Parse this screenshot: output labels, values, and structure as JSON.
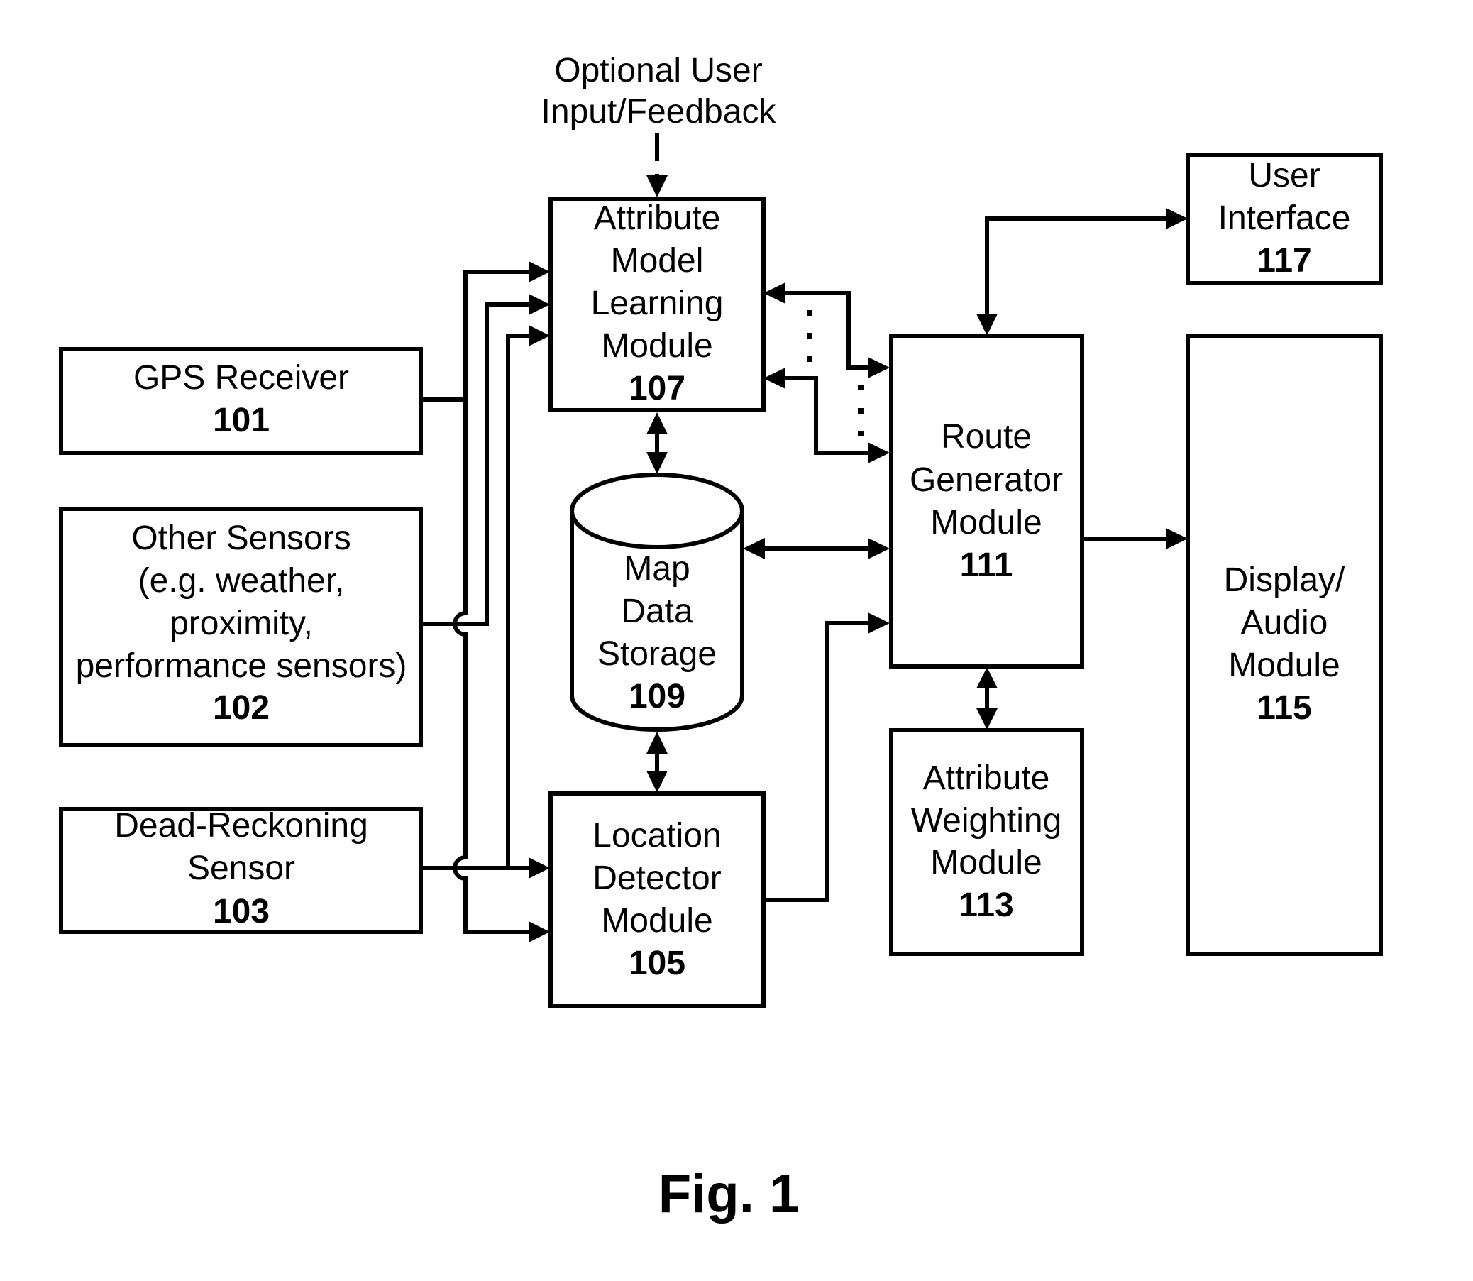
{
  "figure": {
    "caption": "Fig. 1",
    "external_input": {
      "lines": [
        "Optional User",
        "Input/Feedback"
      ]
    },
    "blocks": {
      "gps": {
        "lines": [
          "GPS Receiver"
        ],
        "ref": "101"
      },
      "other_sensors": {
        "lines": [
          "Other Sensors",
          "(e.g. weather,",
          "proximity,",
          "performance sensors)"
        ],
        "ref": "102"
      },
      "dead_reckoning": {
        "lines": [
          "Dead-Reckoning",
          "Sensor"
        ],
        "ref": "103"
      },
      "location_detector": {
        "lines": [
          "Location",
          "Detector",
          "Module"
        ],
        "ref": "105"
      },
      "attribute_model_learning": {
        "lines": [
          "Attribute",
          "Model",
          "Learning",
          "Module"
        ],
        "ref": "107"
      },
      "map_data_storage": {
        "lines": [
          "Map",
          "Data",
          "Storage"
        ],
        "ref": "109"
      },
      "route_generator": {
        "lines": [
          "Route",
          "Generator",
          "Module"
        ],
        "ref": "111"
      },
      "attribute_weighting": {
        "lines": [
          "Attribute",
          "Weighting",
          "Module"
        ],
        "ref": "113"
      },
      "display_audio": {
        "lines": [
          "Display/",
          "Audio",
          "Module"
        ],
        "ref": "115"
      },
      "user_interface": {
        "lines": [
          "User",
          "Interface"
        ],
        "ref": "117"
      }
    },
    "connections": [
      {
        "from": "Optional User Input/Feedback",
        "to": "107",
        "style": "dashed",
        "direction": "one-way"
      },
      {
        "from": "101",
        "to": "107",
        "direction": "one-way"
      },
      {
        "from": "101",
        "to": "105",
        "direction": "one-way"
      },
      {
        "from": "102",
        "to": "107",
        "direction": "one-way"
      },
      {
        "from": "103",
        "to": "107",
        "direction": "one-way"
      },
      {
        "from": "103",
        "to": "105",
        "direction": "one-way"
      },
      {
        "from": "107",
        "to": "109",
        "direction": "two-way"
      },
      {
        "from": "109",
        "to": "105",
        "direction": "two-way"
      },
      {
        "from": "109",
        "to": "111",
        "direction": "two-way"
      },
      {
        "from": "107",
        "to": "111",
        "direction": "two-way",
        "multiplicity": "multiple (dotted)"
      },
      {
        "from": "105",
        "to": "111",
        "direction": "one-way"
      },
      {
        "from": "111",
        "to": "113",
        "direction": "two-way"
      },
      {
        "from": "111",
        "to": "115",
        "direction": "one-way"
      },
      {
        "from": "111",
        "to": "117",
        "direction": "two-way"
      }
    ]
  }
}
